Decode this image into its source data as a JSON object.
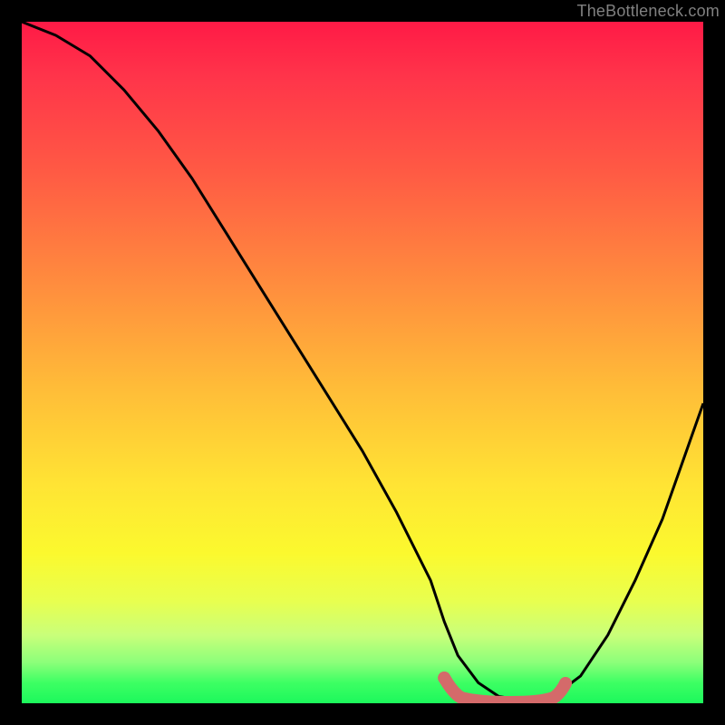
{
  "attribution": "TheBottleneck.com",
  "chart_data": {
    "type": "line",
    "title": "",
    "xlabel": "",
    "ylabel": "",
    "xlim": [
      0,
      100
    ],
    "ylim": [
      0,
      100
    ],
    "series": [
      {
        "name": "curve",
        "x": [
          0,
          5,
          10,
          15,
          20,
          25,
          30,
          35,
          40,
          45,
          50,
          55,
          60,
          62,
          64,
          67,
          70,
          73,
          76,
          78,
          82,
          86,
          90,
          94,
          100
        ],
        "values": [
          100,
          98,
          95,
          90,
          84,
          77,
          69,
          61,
          53,
          45,
          37,
          28,
          18,
          12,
          7,
          3,
          1,
          0.5,
          0.5,
          1,
          4,
          10,
          18,
          27,
          44
        ]
      }
    ],
    "annotations": [
      {
        "name": "minimum-band",
        "x_range": [
          62,
          78
        ],
        "note": "flat valley highlighted in salmon"
      }
    ]
  },
  "colors": {
    "curve": "#000000",
    "valley_highlight": "#d46a6a",
    "background_black": "#000000"
  }
}
